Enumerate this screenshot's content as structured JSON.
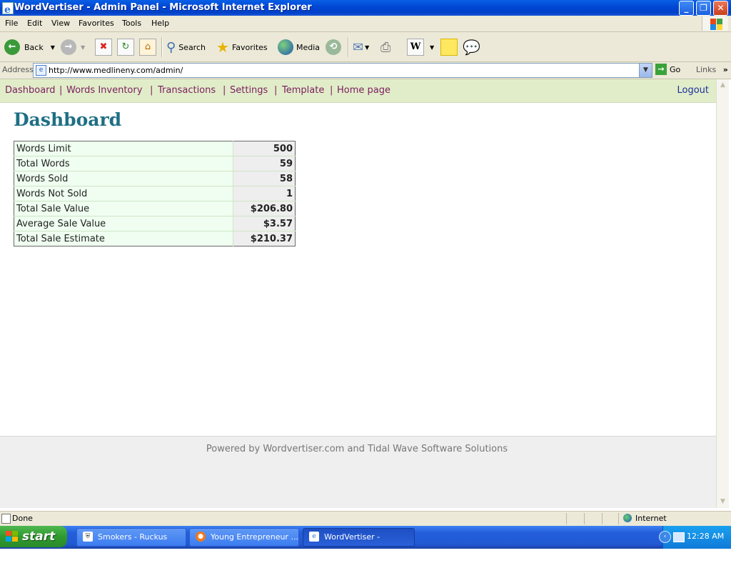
{
  "window": {
    "title": "WordVertiser - Admin Panel - Microsoft Internet Explorer",
    "buttons": [
      "minimize",
      "restore",
      "close"
    ]
  },
  "menu": [
    "File",
    "Edit",
    "View",
    "Favorites",
    "Tools",
    "Help"
  ],
  "toolbar": {
    "back_label": "Back",
    "search_label": "Search",
    "favorites_label": "Favorites",
    "media_label": "Media"
  },
  "address": {
    "label": "Address",
    "url": "http://www.medlineny.com/admin/",
    "go_label": "Go",
    "links_label": "Links"
  },
  "nav": {
    "items": [
      "Dashboard",
      "Words Inventory",
      "Transactions",
      "Settings",
      "Template",
      "Home page"
    ],
    "logout": "Logout"
  },
  "page": {
    "title": "Dashboard",
    "stats": [
      {
        "label": "Words Limit",
        "value": "500"
      },
      {
        "label": "Total Words",
        "value": "59"
      },
      {
        "label": "Words Sold",
        "value": "58"
      },
      {
        "label": "Words Not Sold",
        "value": "1"
      },
      {
        "label": "Total Sale Value",
        "value": "$206.80"
      },
      {
        "label": "Average Sale Value",
        "value": "$3.57"
      },
      {
        "label": "Total Sale Estimate",
        "value": "$210.37"
      }
    ],
    "footer": "Powered by Wordvertiser.com and Tidal Wave Software Solutions"
  },
  "statusbar": {
    "status": "Done",
    "zone": "Internet"
  },
  "taskbar": {
    "start_label": "start",
    "tasks": [
      {
        "label": "Smokers - Ruckus",
        "active": false
      },
      {
        "label": "Young Entrepreneur ...",
        "active": false
      },
      {
        "label": "WordVertiser - Admin...",
        "active": true
      }
    ],
    "clock": "12:28 AM"
  }
}
